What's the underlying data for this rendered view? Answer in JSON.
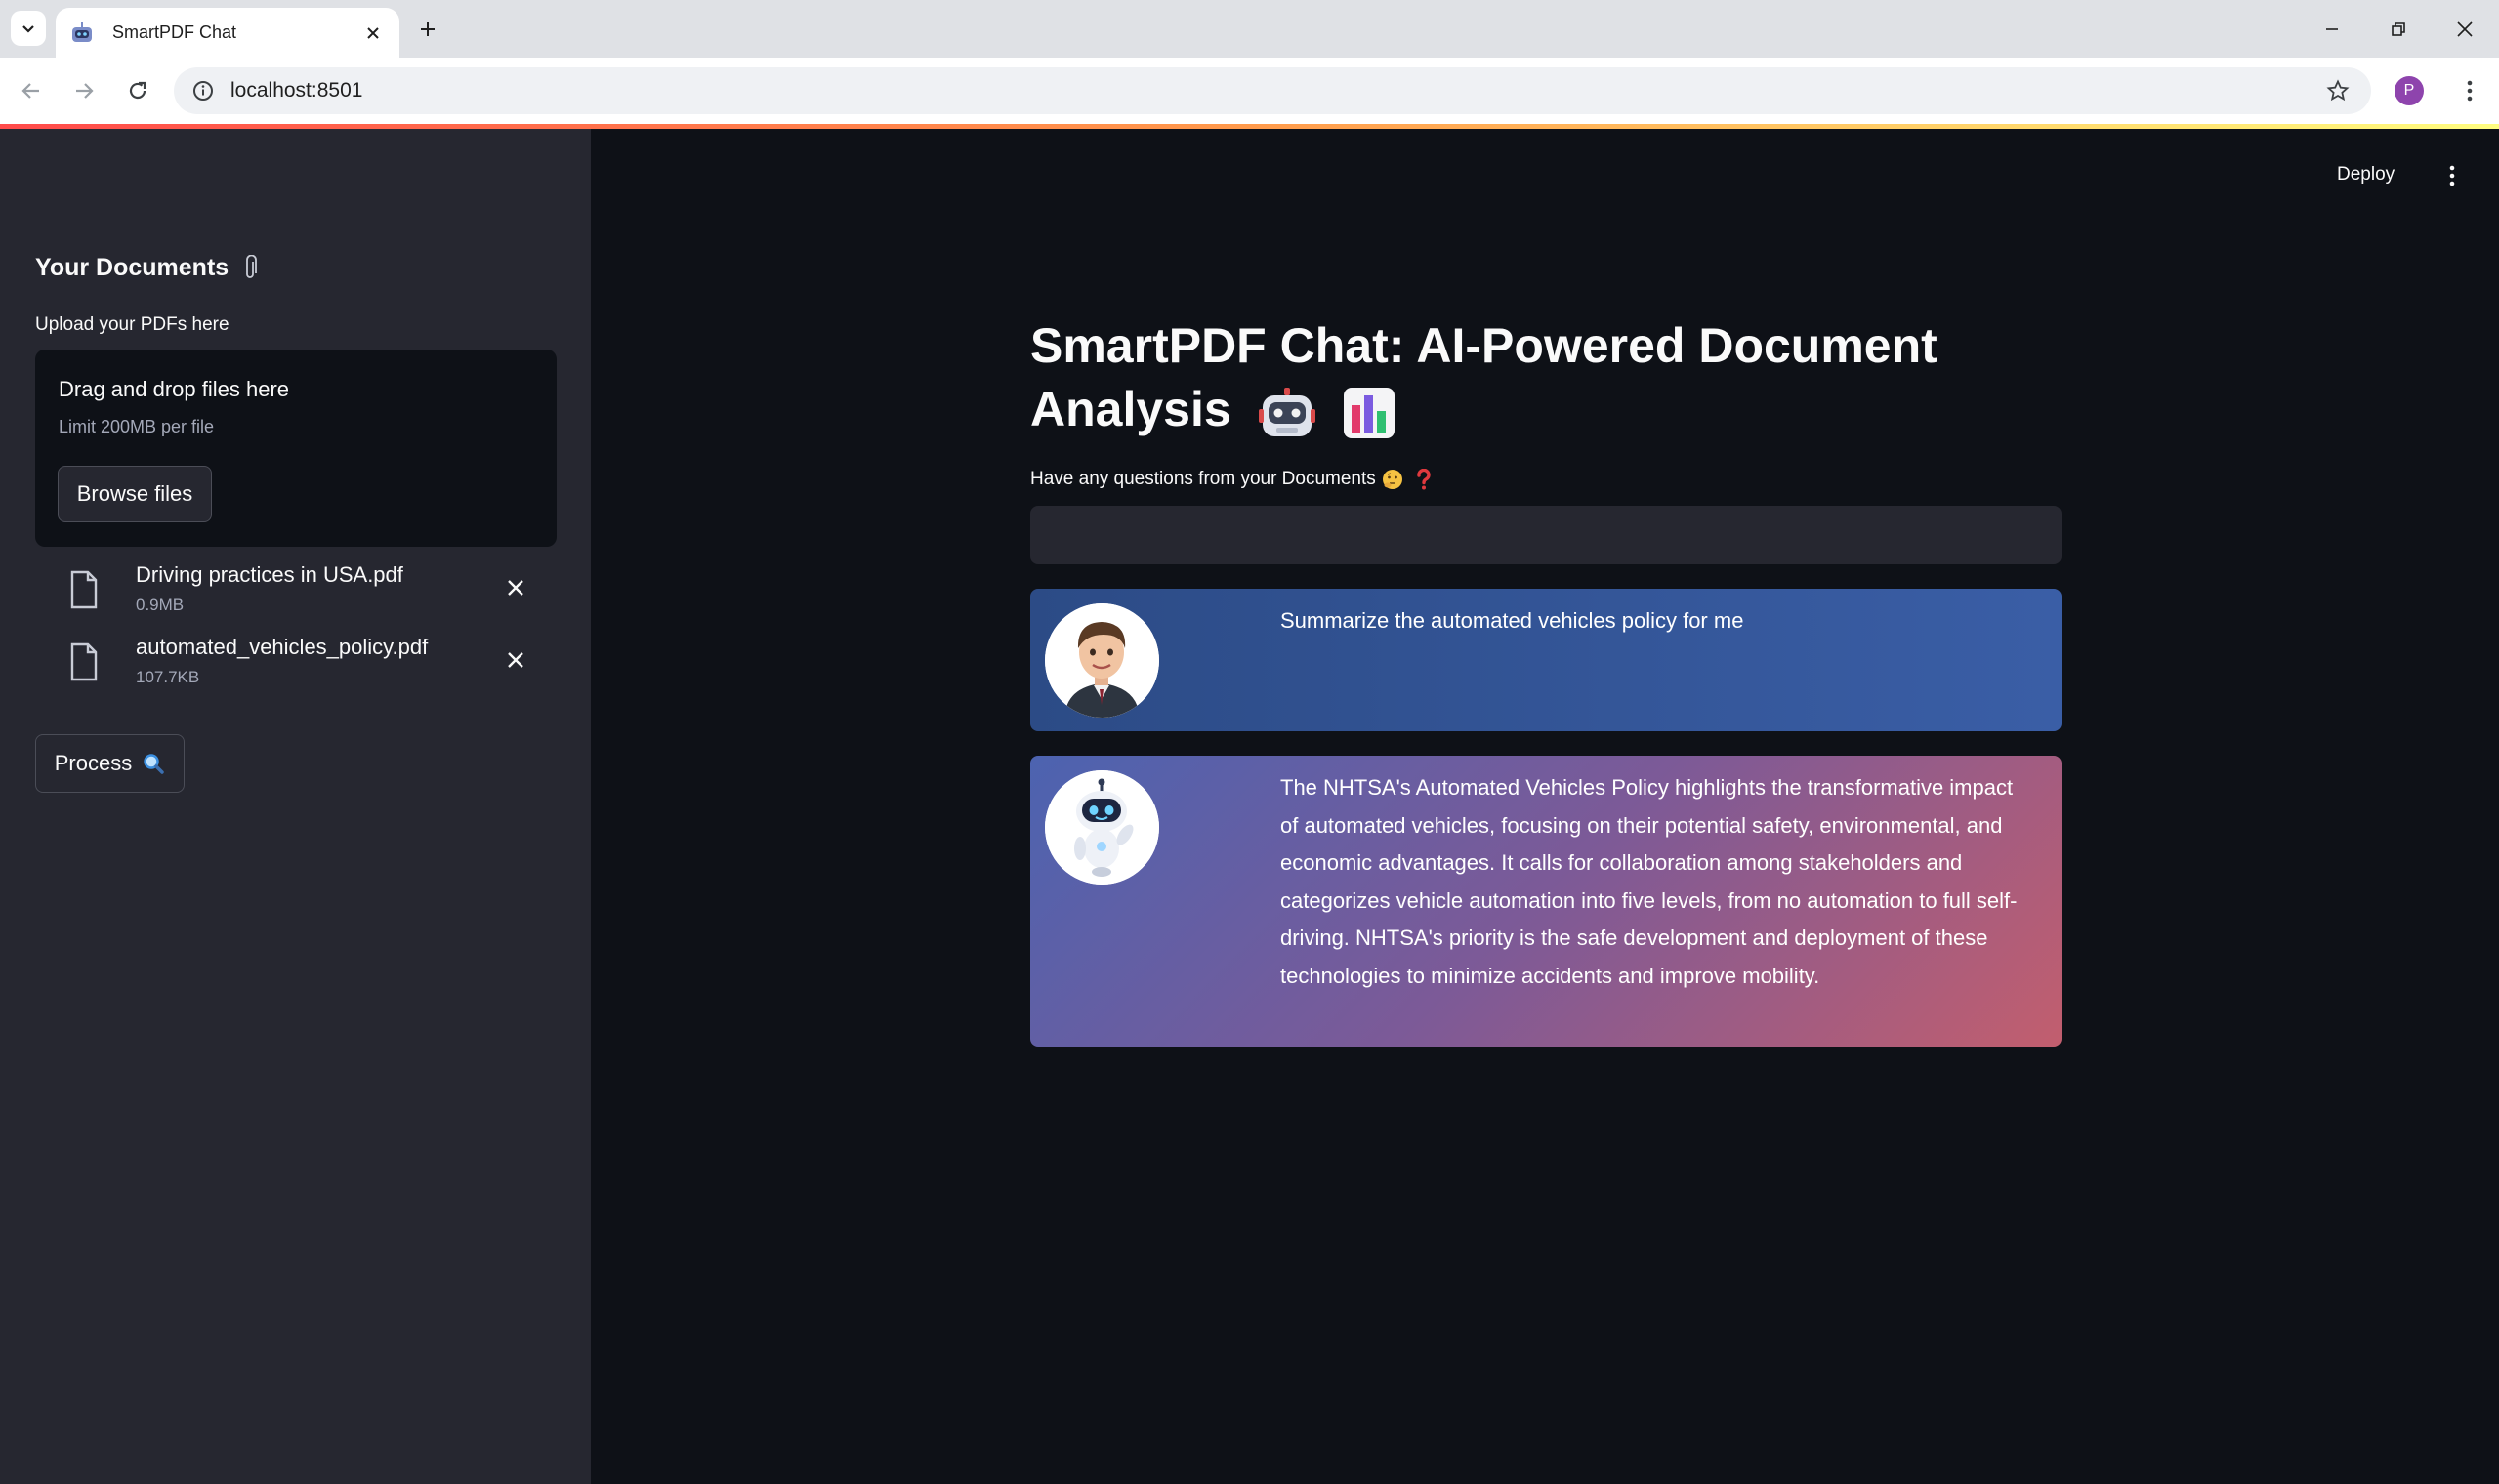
{
  "browser": {
    "tab_title": "SmartPDF Chat",
    "url": "localhost:8501",
    "profile_initial": "P"
  },
  "sidebar": {
    "title": "Your Documents",
    "upload_label": "Upload your PDFs here",
    "dropzone": {
      "title": "Drag and drop files here",
      "limit": "Limit 200MB per file",
      "browse_label": "Browse files"
    },
    "files": [
      {
        "name": "Driving practices in USA.pdf",
        "size": "0.9MB"
      },
      {
        "name": "automated_vehicles_policy.pdf",
        "size": "107.7KB"
      }
    ],
    "process_label": "Process"
  },
  "header": {
    "deploy_label": "Deploy"
  },
  "main": {
    "title_line1": "SmartPDF Chat: AI-Powered Document",
    "title_line2": "Analysis",
    "question_label": "Have any questions from your Documents",
    "question_value": "",
    "messages": [
      {
        "role": "user",
        "text": "Summarize the automated vehicles policy for me"
      },
      {
        "role": "bot",
        "text": "The NHTSA's Automated Vehicles Policy highlights the transformative impact of automated vehicles, focusing on their potential safety, environmental, and economic advantages. It calls for collaboration among stakeholders and categorizes vehicle automation into five levels, from no automation to full self-driving. NHTSA's priority is the safe development and deployment of these technologies to minimize accidents and improve mobility."
      }
    ]
  },
  "colors": {
    "sidebar_bg": "#262730",
    "main_bg": "#0e1117",
    "user_msg_bg": "#2c4b86",
    "bot_msg_gradient_start": "#4c63b0",
    "bot_msg_gradient_end": "#c25e6e"
  },
  "icons": [
    "tab-list-icon",
    "robot-favicon-icon",
    "close-icon",
    "plus-icon",
    "minimize-icon",
    "restore-icon",
    "back-arrow-icon",
    "forward-arrow-icon",
    "reload-icon",
    "info-icon",
    "star-icon",
    "kebab-menu-icon",
    "paperclip-icon",
    "file-icon",
    "magnifier-icon",
    "robot-emoji-icon",
    "bar-chart-emoji-icon",
    "thinking-face-icon",
    "question-mark-icon",
    "user-avatar-icon",
    "bot-avatar-icon"
  ]
}
